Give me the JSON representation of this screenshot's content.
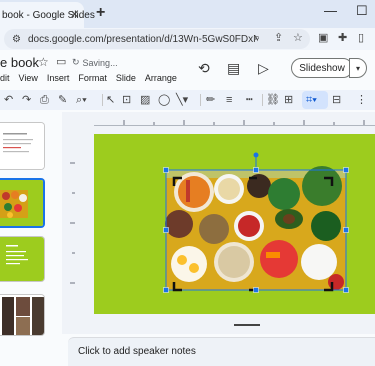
{
  "browser": {
    "tab_title": "book - Google Slides",
    "url": "docs.google.com/presentation/d/13Wn-5GwS0FDxNI-1...",
    "window_controls": [
      "minimize-icon",
      "maximize-icon"
    ]
  },
  "header": {
    "title": "e book",
    "status": "Saving...",
    "menu": [
      "dit",
      "View",
      "Insert",
      "Format",
      "Slide",
      "Arrange"
    ],
    "slideshow_label": "Slideshow"
  },
  "toolbar": {
    "icons": [
      "undo-icon",
      "redo-icon",
      "print-icon",
      "paint-format-icon",
      "zoom-icon",
      "select-icon",
      "text-box-icon",
      "image-icon",
      "shape-icon",
      "line-icon",
      "pen-icon",
      "border-weight-icon",
      "border-dash-icon",
      "link-icon",
      "comment-icon",
      "crop-icon",
      "replace-image-icon",
      "more-icon"
    ]
  },
  "filmstrip": {
    "slides": [
      {
        "number": "",
        "kind": "text-slide"
      },
      {
        "number": "",
        "kind": "food-image-slide",
        "selected": true
      },
      {
        "number": "",
        "kind": "green-text-slide"
      },
      {
        "number": "",
        "kind": "photo-slide"
      }
    ]
  },
  "slide": {
    "background_color": "#9dcc1e",
    "image_subject": "bowls of salad, eggs, grains and vegetables"
  },
  "notes": {
    "placeholder": "Click to add speaker notes"
  },
  "colors": {
    "accent": "#1a73e8",
    "slide_green": "#9dcc1e",
    "selected_thumb_border": "#1a73e8"
  }
}
